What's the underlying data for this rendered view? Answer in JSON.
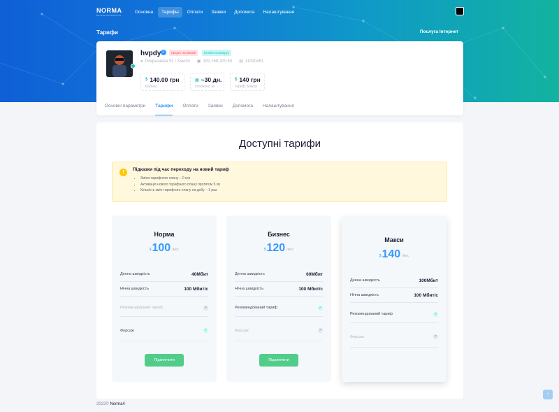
{
  "topbar": {
    "logo_main": "NORMA",
    "logo_sub": "BILLING INFORMATION",
    "nav": [
      {
        "label": "Основна",
        "active": false
      },
      {
        "label": "Тарифы",
        "active": true
      },
      {
        "label": "Оплати",
        "active": false
      },
      {
        "label": "Заявки",
        "active": false
      },
      {
        "label": "Допомога",
        "active": false
      },
      {
        "label": "Налаштування",
        "active": false
      }
    ]
  },
  "header": {
    "page_title": "Тарифи",
    "service_link": "Послуга Інтернет"
  },
  "profile": {
    "name": "hvpdy",
    "badge_credit": "Кредит активний",
    "badge_drweb": "DrWeb активирус",
    "address": "Покрышева 51 / Xiaomi",
    "ip": "192.168.200.50",
    "account_id": "11930461",
    "stats": [
      {
        "value": "140.00 грн",
        "label": "Баланс",
        "icon": "$"
      },
      {
        "value": "~30 дн.",
        "label": "сплачено за",
        "icon": "▦"
      },
      {
        "value": "140 грн",
        "label": "тариф: Макси",
        "icon": "$"
      }
    ]
  },
  "tabs": [
    {
      "label": "Основні параметри",
      "active": false
    },
    {
      "label": "Тарифи",
      "active": true
    },
    {
      "label": "Оплати",
      "active": false
    },
    {
      "label": "Заявки",
      "active": false
    },
    {
      "label": "Допомога",
      "active": false
    },
    {
      "label": "Налаштування",
      "active": false
    }
  ],
  "section": {
    "title": "Доступні тарифи"
  },
  "alert": {
    "title": "Підказки під час переходу на новий тариф",
    "items": [
      "Зміна тарифного плану – 0 грн",
      "Активація нового тарифного плану протягом 5 хв",
      "Кількість змін тарифного плану на добу – 1 раз"
    ]
  },
  "plans": [
    {
      "name": "Норма",
      "currency": "$",
      "price": "100",
      "period": "/мес",
      "features": [
        {
          "label": "Денна швидкість",
          "value": "40Мбит"
        },
        {
          "label": "Нічна швидкість",
          "value": "100 Мбит/с"
        },
        {
          "label": "Рекомендований тариф",
          "mark": "no"
        },
        {
          "label": "Форсаж",
          "mark": "yes"
        }
      ],
      "button": "Підключити"
    },
    {
      "name": "Бизнес",
      "currency": "$",
      "price": "120",
      "period": "/мес",
      "features": [
        {
          "label": "Денна швидкість",
          "value": "60Мбит"
        },
        {
          "label": "Нічна швидкість",
          "value": "100 Мбит/с"
        },
        {
          "label": "Рекомендований тариф",
          "mark": "yes"
        },
        {
          "label": "Форсаж",
          "mark": "no"
        }
      ],
      "button": "Підключити"
    },
    {
      "name": "Макси",
      "currency": "$",
      "price": "140",
      "period": "/мес",
      "features": [
        {
          "label": "Денна швидкість",
          "value": "100Мбит"
        },
        {
          "label": "Нічна швидкість",
          "value": "100 Мбит/с"
        },
        {
          "label": "Рекомендований тариф",
          "mark": "yes"
        },
        {
          "label": "Форсаж",
          "mark": "no"
        }
      ]
    }
  ],
  "footer": {
    "year": "2022©",
    "brand": "Norma4"
  },
  "colors": {
    "primary": "#3699ff",
    "success": "#50cd89",
    "warning_bg": "#fff8dd"
  }
}
